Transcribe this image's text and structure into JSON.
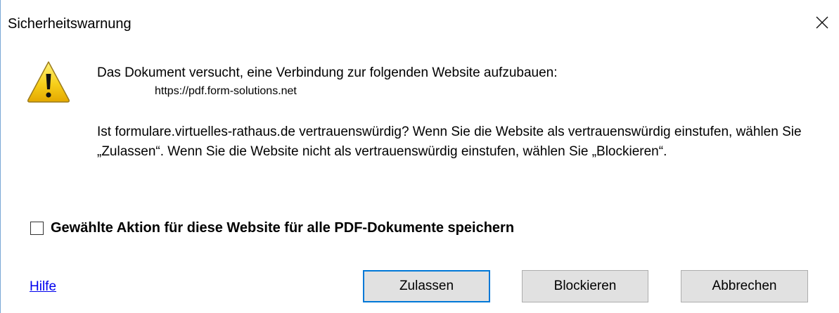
{
  "window": {
    "title": "Sicherheitswarnung",
    "close_icon": "close-icon"
  },
  "content": {
    "icon": "warning-icon",
    "message": "Das Dokument versucht, eine Verbindung zur folgenden Website aufzubauen:",
    "url": "https://pdf.form-solutions.net",
    "question": "Ist formulare.virtuelles-rathaus.de vertrauenswürdig? Wenn Sie die Website als vertrauenswürdig einstufen, wählen Sie „Zulassen“. Wenn Sie die Website nicht als vertrauenswürdig einstufen, wählen Sie „Blockieren“."
  },
  "checkbox": {
    "checked": false,
    "label": "Gewählte Aktion für diese Website für alle PDF-Dokumente speichern"
  },
  "footer": {
    "help_label": "Hilfe",
    "buttons": {
      "allow": "Zulassen",
      "block": "Blockieren",
      "cancel": "Abbrechen"
    }
  },
  "colors": {
    "link": "#0000ee",
    "default_button_border": "#0078d7",
    "button_bg": "#e1e1e1",
    "warning_yellow": "#f5c400"
  }
}
